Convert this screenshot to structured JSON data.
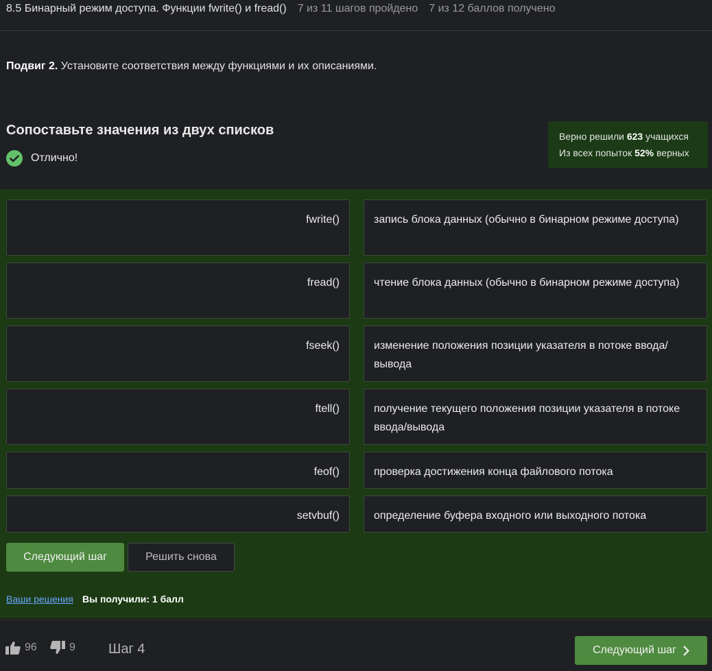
{
  "topbar": {
    "title": "8.5 Бинарный режим доступа. Функции fwrite() и fread()",
    "steps_progress": "7 из 11 шагов пройдено",
    "points_progress": "7 из 12 баллов  получено"
  },
  "task": {
    "bold": "Подвиг 2.",
    "text": " Установите соответствия между функциями и их описаниями."
  },
  "quiz": {
    "heading": "Сопоставьте значения из двух списков",
    "status": "Отлично!",
    "stats": {
      "line1_prefix": "Верно решили ",
      "line1_value": "623",
      "line1_suffix": " учащихся",
      "line2_prefix": "Из всех попыток ",
      "line2_value": "52%",
      "line2_suffix": " верных"
    },
    "pairs": [
      {
        "left": "fwrite()",
        "right": "запись блока данных (обычно в бинарном режиме доступа)"
      },
      {
        "left": "fread()",
        "right": "чтение блока данных (обычно в бинарном режиме доступа)"
      },
      {
        "left": "fseek()",
        "right": "изменение положения позиции указателя в потоке ввода/вывода"
      },
      {
        "left": "ftell()",
        "right": "получение текущего положения позиции указателя в потоке ввода/вывода"
      },
      {
        "left": "feof()",
        "right": "проверка достижения конца файлового потока"
      },
      {
        "left": "setvbuf()",
        "right": "определение буфера входного или выходного потока"
      }
    ],
    "next_button": "Следующий шаг",
    "retry_button": "Решить снова",
    "solutions_link": "Ваши решения",
    "score_label": "Вы получили: ",
    "score_value": "1 балл"
  },
  "footer": {
    "likes": "96",
    "dislikes": "9",
    "step": "Шаг 4",
    "next_button": "Следующий шаг"
  },
  "colors": {
    "background": "#1f2023",
    "match_area": "#1c3a14",
    "accent_green": "#4e8a3f",
    "check_green": "#63c16a"
  }
}
